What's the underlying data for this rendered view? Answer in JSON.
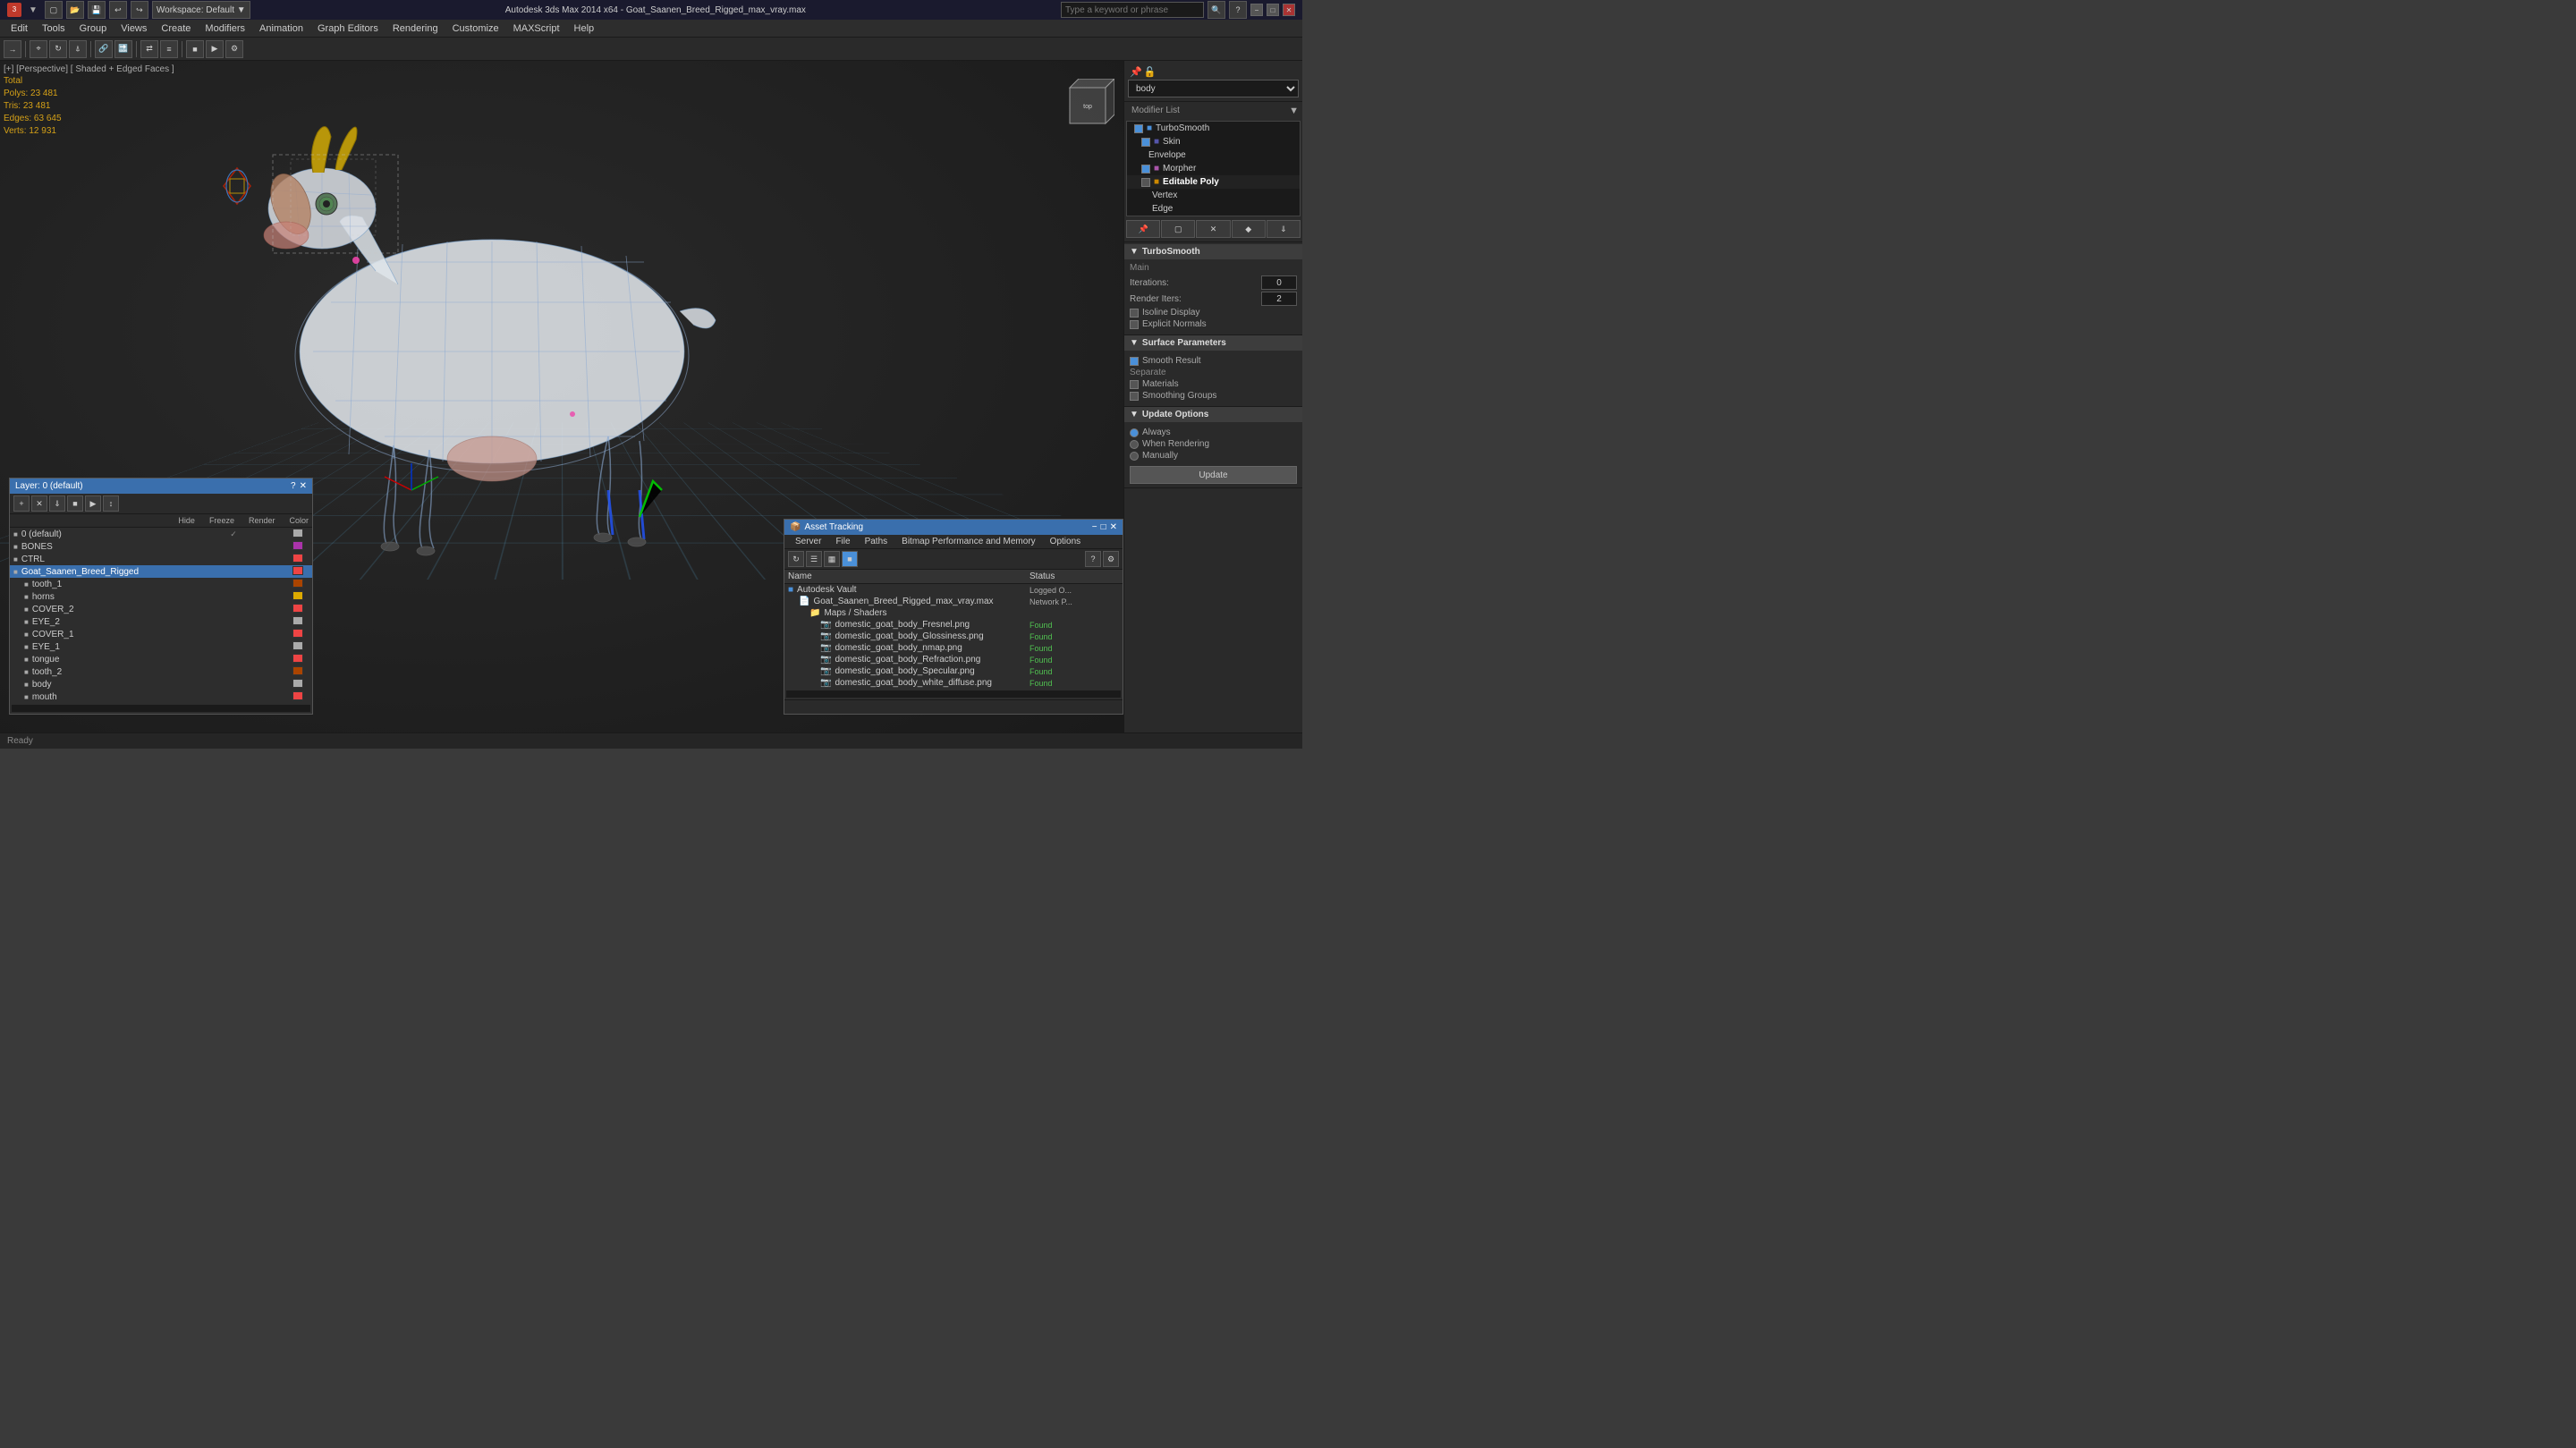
{
  "titlebar": {
    "app_icon": "3ds-max-icon",
    "title": "Autodesk 3ds Max 2014 x64 - Goat_Saanen_Breed_Rigged_max_vray.max",
    "search_placeholder": "Type a keyword or phrase",
    "minimize": "−",
    "maximize": "□",
    "close": "✕"
  },
  "menu": {
    "items": [
      "Edit",
      "Tools",
      "Group",
      "Views",
      "Create",
      "Modifiers",
      "Animation",
      "Graph Editors",
      "Rendering",
      "Customize",
      "MAXScript",
      "Help"
    ]
  },
  "viewport": {
    "label": "[+] [Perspective] [ Shaded + Edged Faces ]",
    "stats": {
      "total_label": "Total",
      "polys_label": "Polys:",
      "polys_val": "23 481",
      "tris_label": "Tris:",
      "tris_val": "23 481",
      "edges_label": "Edges:",
      "edges_val": "63 645",
      "verts_label": "Verts:",
      "verts_val": "12 931"
    }
  },
  "right_panel": {
    "object_name": "body",
    "modifier_list_label": "Modifier List",
    "modifiers": [
      {
        "name": "TurboSmooth",
        "level": 0,
        "active": true
      },
      {
        "name": "Skin",
        "level": 1,
        "active": true
      },
      {
        "name": "Envelope",
        "level": 2,
        "active": false
      },
      {
        "name": "Morpher",
        "level": 1,
        "active": true
      },
      {
        "name": "Editable Poly",
        "level": 1,
        "active": false,
        "group": true
      },
      {
        "name": "Vertex",
        "level": 2,
        "active": false
      },
      {
        "name": "Edge",
        "level": 2,
        "active": false
      }
    ],
    "turbosmooth": {
      "section": "TurboSmooth",
      "main_label": "Main",
      "iterations_label": "Iterations:",
      "iterations_val": "0",
      "render_iters_label": "Render Iters:",
      "render_iters_val": "2",
      "isoline_display_label": "Isoline Display",
      "explicit_normals_label": "Explicit Normals"
    },
    "surface_params": {
      "section": "Surface Parameters",
      "smooth_result_label": "Smooth Result",
      "separate_label": "Separate",
      "materials_label": "Materials",
      "smoothing_groups_label": "Smoothing Groups"
    },
    "update_options": {
      "section": "Update Options",
      "always_label": "Always",
      "when_rendering_label": "When Rendering",
      "manually_label": "Manually",
      "update_btn": "Update"
    }
  },
  "layers_panel": {
    "title": "Layer: 0 (default)",
    "close_btn": "✕",
    "help_btn": "?",
    "columns": [
      "Hide",
      "Freeze",
      "Render",
      "Color"
    ],
    "layers": [
      {
        "name": "0 (default)",
        "indent": 0,
        "selected": false,
        "hide": "✓",
        "color": "#aaaaaa"
      },
      {
        "name": "BONES",
        "indent": 0,
        "selected": false,
        "color": "#aa33aa"
      },
      {
        "name": "CTRL",
        "indent": 0,
        "selected": false,
        "color": "#ee4444"
      },
      {
        "name": "Goat_Saanen_Breed_Rigged",
        "indent": 0,
        "selected": true,
        "color": "#ee4444"
      },
      {
        "name": "tooth_1",
        "indent": 1,
        "selected": false,
        "color": "#aa4400"
      },
      {
        "name": "horns",
        "indent": 1,
        "selected": false,
        "color": "#ddaa00"
      },
      {
        "name": "COVER_2",
        "indent": 1,
        "selected": false,
        "color": "#ee4444"
      },
      {
        "name": "EYE_2",
        "indent": 1,
        "selected": false,
        "color": "#aaaaaa"
      },
      {
        "name": "COVER_1",
        "indent": 1,
        "selected": false,
        "color": "#ee4444"
      },
      {
        "name": "EYE_1",
        "indent": 1,
        "selected": false,
        "color": "#aaaaaa"
      },
      {
        "name": "tongue",
        "indent": 1,
        "selected": false,
        "color": "#ee4444"
      },
      {
        "name": "tooth_2",
        "indent": 1,
        "selected": false,
        "color": "#aa4400"
      },
      {
        "name": "body",
        "indent": 1,
        "selected": false,
        "color": "#aaaaaa"
      },
      {
        "name": "mouth",
        "indent": 1,
        "selected": false,
        "color": "#ee4444"
      }
    ]
  },
  "asset_panel": {
    "title": "Asset Tracking",
    "close_btn": "✕",
    "menu_items": [
      "Server",
      "File",
      "Paths",
      "Bitmap Performance and Memory",
      "Options"
    ],
    "col_name": "Name",
    "col_status": "Status",
    "assets": [
      {
        "name": "Autodesk Vault",
        "indent": 0,
        "type": "vault",
        "status": "Logged O..."
      },
      {
        "name": "Goat_Saanen_Breed_Rigged_max_vray.max",
        "indent": 1,
        "type": "file",
        "status": "Network P..."
      },
      {
        "name": "Maps / Shaders",
        "indent": 2,
        "type": "folder"
      },
      {
        "name": "domestic_goat_body_Fresnel.png",
        "indent": 3,
        "type": "image",
        "status": "Found"
      },
      {
        "name": "domestic_goat_body_Glossiness.png",
        "indent": 3,
        "type": "image",
        "status": "Found"
      },
      {
        "name": "domestic_goat_body_nmap.png",
        "indent": 3,
        "type": "image",
        "status": "Found"
      },
      {
        "name": "domestic_goat_body_Refraction.png",
        "indent": 3,
        "type": "image",
        "status": "Found"
      },
      {
        "name": "domestic_goat_body_Specular.png",
        "indent": 3,
        "type": "image",
        "status": "Found"
      },
      {
        "name": "domestic_goat_body_white_diffuse.png",
        "indent": 3,
        "type": "image",
        "status": "Found"
      }
    ]
  }
}
